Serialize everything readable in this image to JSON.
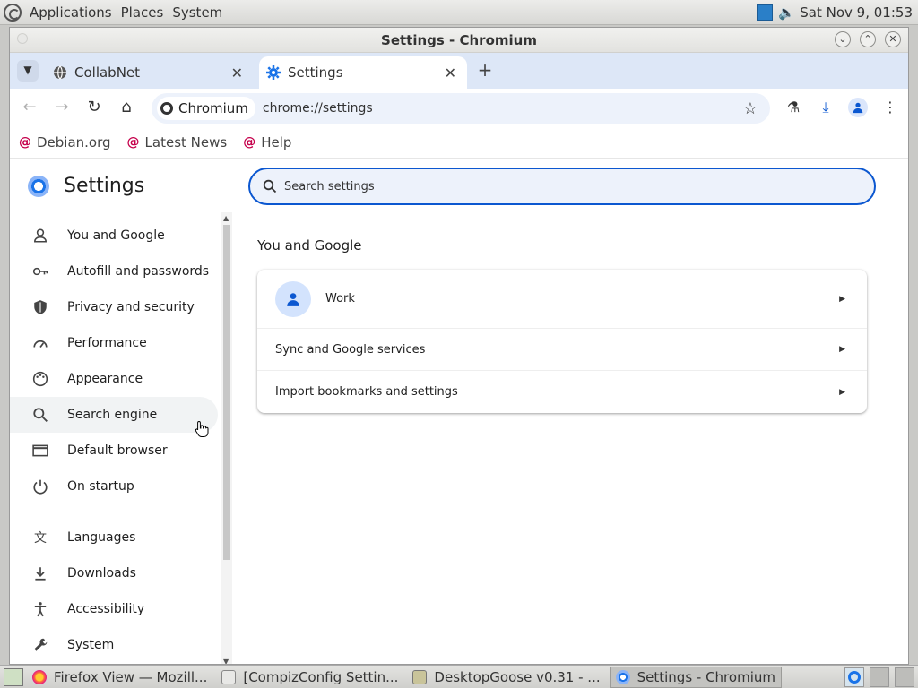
{
  "top_panel": {
    "menus": [
      "Applications",
      "Places",
      "System"
    ],
    "clock": "Sat Nov 9, 01:53"
  },
  "window": {
    "title": "Settings - Chromium"
  },
  "tabs": [
    {
      "label": "CollabNet",
      "icon": "globe-icon",
      "active": false
    },
    {
      "label": "Settings",
      "icon": "gear-icon",
      "active": true
    }
  ],
  "toolbar": {
    "chip_label": "Chromium",
    "url": "chrome://settings"
  },
  "bookmarks": [
    {
      "label": "Debian.org"
    },
    {
      "label": "Latest News"
    },
    {
      "label": "Help"
    }
  ],
  "settings": {
    "brand": "Settings",
    "search_placeholder": "Search settings",
    "nav": [
      {
        "label": "You and Google",
        "icon": "person-icon"
      },
      {
        "label": "Autofill and passwords",
        "icon": "key-icon"
      },
      {
        "label": "Privacy and security",
        "icon": "shield-icon"
      },
      {
        "label": "Performance",
        "icon": "speedometer-icon"
      },
      {
        "label": "Appearance",
        "icon": "palette-icon"
      },
      {
        "label": "Search engine",
        "icon": "search-icon"
      },
      {
        "label": "Default browser",
        "icon": "browser-icon"
      },
      {
        "label": "On startup",
        "icon": "power-icon"
      },
      {
        "label": "Languages",
        "icon": "translate-icon"
      },
      {
        "label": "Downloads",
        "icon": "download-icon"
      },
      {
        "label": "Accessibility",
        "icon": "accessibility-icon"
      },
      {
        "label": "System",
        "icon": "wrench-icon"
      }
    ],
    "section_title": "You and Google",
    "card": {
      "profile_name": "Work",
      "sync_label": "Sync and Google services",
      "import_label": "Import bookmarks and settings"
    }
  },
  "taskbar": {
    "tasks": [
      {
        "label": "Firefox View — Mozill...",
        "active": false
      },
      {
        "label": "[CompizConfig Settin...",
        "active": false
      },
      {
        "label": "DesktopGoose v0.31 - ...",
        "active": false
      },
      {
        "label": "Settings - Chromium",
        "active": true
      }
    ]
  }
}
